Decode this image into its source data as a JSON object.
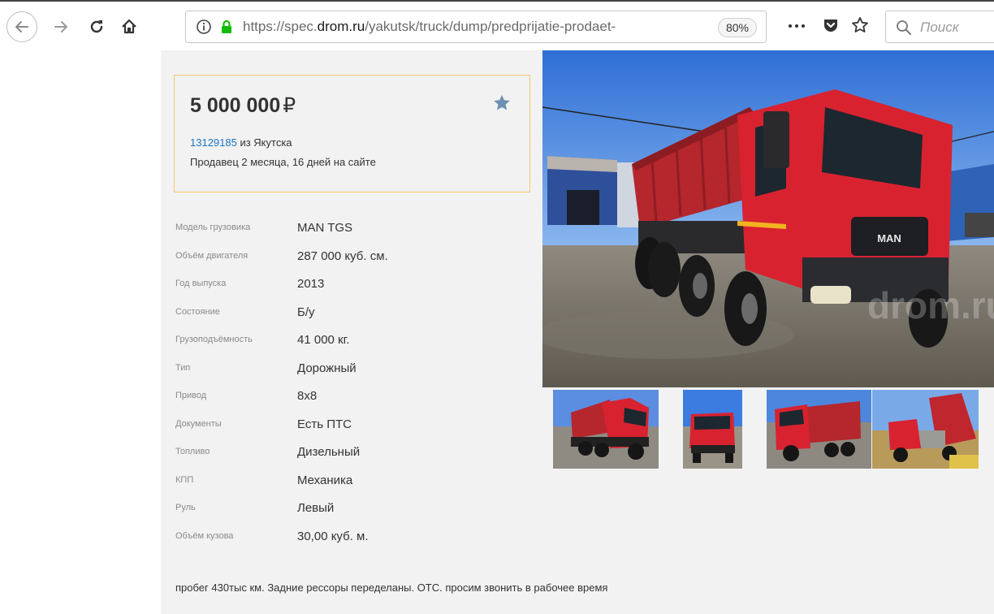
{
  "browser": {
    "url_prefix": "https://spec.",
    "url_domain": "drom.ru",
    "url_path": "/yakutsk/truck/dump/predprijatie-prodaet-",
    "zoom": "80%",
    "search_placeholder": "Поиск"
  },
  "listing": {
    "price": "5 000 000",
    "currency": "₽",
    "ad_id": "13129185",
    "location_text": " из Якутска",
    "seller_text": "Продавец 2 месяца, 16 дней на сайте",
    "specs": [
      {
        "label": "Модель грузовика",
        "value": "MAN TGS"
      },
      {
        "label": "Объём двигателя",
        "value": "287 000 куб. см."
      },
      {
        "label": "Год выпуска",
        "value": "2013"
      },
      {
        "label": "Состояние",
        "value": "Б/у"
      },
      {
        "label": "Грузоподъёмность",
        "value": "41 000 кг."
      },
      {
        "label": "Тип",
        "value": "Дорожный"
      },
      {
        "label": "Привод",
        "value": "8x8"
      },
      {
        "label": "Документы",
        "value": "Есть ПТС"
      },
      {
        "label": "Топливо",
        "value": "Дизельный"
      },
      {
        "label": "КПП",
        "value": "Механика"
      },
      {
        "label": "Руль",
        "value": "Левый"
      },
      {
        "label": "Объём кузова",
        "value": "30,00 куб. м."
      }
    ],
    "description": "пробег 430тыс км. Задние рессоры переделаны. ОТС. просим звонить в рабочее время"
  },
  "photos": {
    "watermark": "drom.ru",
    "truck_logo": "MAN",
    "thumb_count": 4
  },
  "colors": {
    "accent_border": "#f4c76b",
    "link": "#1a74c4",
    "star": "#6f8fb0",
    "truck_red": "#d8222f",
    "secure_green": "#12bc00"
  }
}
